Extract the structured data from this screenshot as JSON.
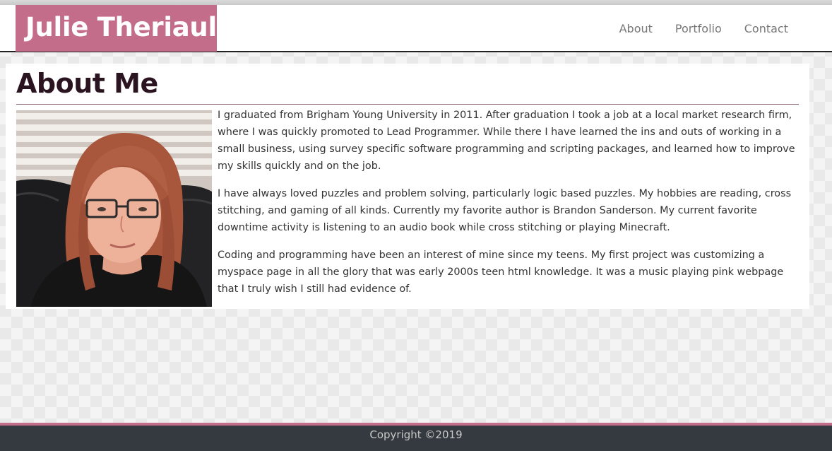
{
  "header": {
    "brand": "Julie Theriault",
    "nav": [
      "About",
      "Portfolio",
      "Contact"
    ]
  },
  "main": {
    "title": "About Me",
    "paragraphs": [
      "I graduated from Brigham Young University in 2011. After graduation I took a job at a local market research firm, where I was quickly promoted to Lead Programmer. While there I have learned the ins and outs of working in a small business, using survey specific software programming and scripting packages, and learned how to improve my skills quickly and on the job.",
      "I have always loved puzzles and problem solving, particularly logic based puzzles. My hobbies are reading, cross stitching, and gaming of all kinds. Currently my favorite author is Brandon Sanderson. My current favorite downtime activity is listening to an audio book while cross stitching or playing Minecraft.",
      "Coding and programming have been an interest of mine since my teens. My first project was customizing a myspace page in all the glory that was early 2000s teen html knowledge. It was a music playing pink webpage that I truly wish I still had evidence of."
    ]
  },
  "footer": {
    "copyright": "Copyright ©2019"
  },
  "colors": {
    "brand": "#c46d8b",
    "footer": "#343a40",
    "title": "#2a1420"
  }
}
